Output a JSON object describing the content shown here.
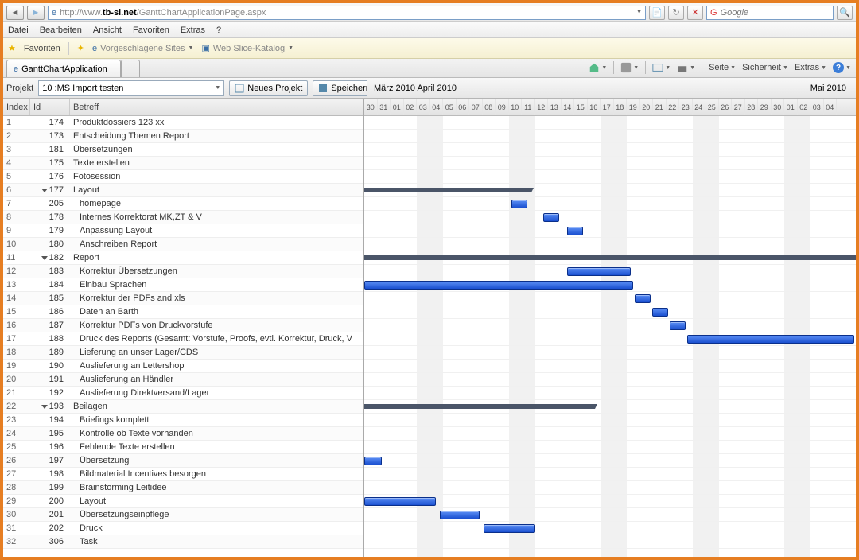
{
  "url_prefix": "http://www.",
  "url_domain": "tb-sl.net",
  "url_path": "/GanttChartApplicationPage.aspx",
  "search_engine": "Google",
  "menu": [
    "Datei",
    "Bearbeiten",
    "Ansicht",
    "Favoriten",
    "Extras",
    "?"
  ],
  "fav_label": "Favoriten",
  "fav_links": [
    "Vorgeschlagene Sites",
    "Web Slice-Katalog"
  ],
  "tab_title": "GanttChartApplication",
  "page_tools": [
    "Seite",
    "Sicherheit",
    "Extras"
  ],
  "project_label": "Projekt",
  "project_value": "10 :MS Import testen",
  "btn_new": "Neues Projekt",
  "btn_save": "Speichern",
  "month_left": "März 2010",
  "month_mid": "April 2010",
  "month_right": "Mai 2010",
  "col_index": "Index",
  "col_id": "Id",
  "col_betreff": "Betreff",
  "days": [
    "30",
    "31",
    "01",
    "02",
    "03",
    "04",
    "05",
    "06",
    "07",
    "08",
    "09",
    "10",
    "11",
    "12",
    "13",
    "14",
    "15",
    "16",
    "17",
    "18",
    "19",
    "20",
    "21",
    "22",
    "23",
    "24",
    "25",
    "26",
    "27",
    "28",
    "29",
    "30",
    "01",
    "02",
    "03",
    "04"
  ],
  "tasks": [
    {
      "idx": 1,
      "id": 174,
      "t": "Produktdossiers 123 xx"
    },
    {
      "idx": 2,
      "id": 173,
      "t": "Entscheidung Themen Report"
    },
    {
      "idx": 3,
      "id": 181,
      "t": "Übersetzungen"
    },
    {
      "idx": 4,
      "id": 175,
      "t": "Texte erstellen"
    },
    {
      "idx": 5,
      "id": 176,
      "t": "Fotosession"
    },
    {
      "idx": 6,
      "id": 177,
      "t": "Layout",
      "grp": true,
      "sum": [
        0,
        210
      ]
    },
    {
      "idx": 7,
      "id": 205,
      "t": "homepage",
      "bar": [
        185,
        20
      ]
    },
    {
      "idx": 8,
      "id": 178,
      "t": "Internes Korrektorat MK,ZT & V",
      "bar": [
        225,
        20
      ]
    },
    {
      "idx": 9,
      "id": 179,
      "t": "Anpassung Layout",
      "bar": [
        255,
        20
      ]
    },
    {
      "idx": 10,
      "id": 180,
      "t": "Anschreiben Report"
    },
    {
      "idx": 11,
      "id": 182,
      "t": "Report",
      "grp": true,
      "sum": [
        0,
        620
      ]
    },
    {
      "idx": 12,
      "id": 183,
      "t": "Korrektur Übersetzungen",
      "bar": [
        255,
        80
      ]
    },
    {
      "idx": 13,
      "id": 184,
      "t": "Einbau Sprachen",
      "bar": [
        0,
        338
      ]
    },
    {
      "idx": 14,
      "id": 185,
      "t": "Korrektur der PDFs and xls",
      "bar": [
        340,
        20
      ]
    },
    {
      "idx": 15,
      "id": 186,
      "t": "Daten an Barth",
      "bar": [
        362,
        20
      ]
    },
    {
      "idx": 16,
      "id": 187,
      "t": "Korrektur PDFs von Druckvorstufe",
      "bar": [
        384,
        20
      ]
    },
    {
      "idx": 17,
      "id": 188,
      "t": "Druck des Reports (Gesamt: Vorstufe, Proofs, evtl. Korrektur, Druck, V",
      "bar": [
        406,
        210
      ]
    },
    {
      "idx": 18,
      "id": 189,
      "t": "Lieferung an unser Lager/CDS"
    },
    {
      "idx": 19,
      "id": 190,
      "t": "Auslieferung an Lettershop"
    },
    {
      "idx": 20,
      "id": 191,
      "t": "Auslieferung an Händler"
    },
    {
      "idx": 21,
      "id": 192,
      "t": "Auslieferung Direktversand/Lager"
    },
    {
      "idx": 22,
      "id": 193,
      "t": "Beilagen",
      "grp": true,
      "sum": [
        0,
        290
      ]
    },
    {
      "idx": 23,
      "id": 194,
      "t": "Briefings komplett"
    },
    {
      "idx": 24,
      "id": 195,
      "t": "Kontrolle ob Texte vorhanden"
    },
    {
      "idx": 25,
      "id": 196,
      "t": "Fehlende Texte erstellen"
    },
    {
      "idx": 26,
      "id": 197,
      "t": "Übersetzung",
      "bar": [
        0,
        22
      ]
    },
    {
      "idx": 27,
      "id": 198,
      "t": "Bildmaterial Incentives besorgen"
    },
    {
      "idx": 28,
      "id": 199,
      "t": "Brainstorming Leitidee"
    },
    {
      "idx": 29,
      "id": 200,
      "t": "Layout",
      "bar": [
        0,
        90
      ]
    },
    {
      "idx": 30,
      "id": 201,
      "t": "Übersetzungseinpflege",
      "bar": [
        95,
        50
      ]
    },
    {
      "idx": 31,
      "id": 202,
      "t": "Druck",
      "bar": [
        150,
        65
      ]
    },
    {
      "idx": 32,
      "id": 306,
      "t": "Task"
    }
  ],
  "chart_data": {
    "type": "gantt",
    "title": "GanttChartApplication",
    "date_range": [
      "2010-03-30",
      "2010-05-04"
    ],
    "series": [
      {
        "id": 177,
        "name": "Layout",
        "type": "summary",
        "start": "2010-03-30",
        "end": "2010-04-11"
      },
      {
        "id": 205,
        "name": "homepage",
        "start": "2010-04-10",
        "end": "2010-04-11"
      },
      {
        "id": 178,
        "name": "Internes Korrektorat MK,ZT & V",
        "start": "2010-04-13",
        "end": "2010-04-14"
      },
      {
        "id": 179,
        "name": "Anpassung Layout",
        "start": "2010-04-15",
        "end": "2010-04-16"
      },
      {
        "id": 182,
        "name": "Report",
        "type": "summary",
        "start": "2010-03-30",
        "end": "2010-05-04"
      },
      {
        "id": 183,
        "name": "Korrektur Übersetzungen",
        "start": "2010-04-15",
        "end": "2010-04-19"
      },
      {
        "id": 184,
        "name": "Einbau Sprachen",
        "start": "2010-03-30",
        "end": "2010-04-19"
      },
      {
        "id": 185,
        "name": "Korrektur der PDFs and xls",
        "start": "2010-04-20",
        "end": "2010-04-21"
      },
      {
        "id": 186,
        "name": "Daten an Barth",
        "start": "2010-04-21",
        "end": "2010-04-22"
      },
      {
        "id": 187,
        "name": "Korrektur PDFs von Druckvorstufe",
        "start": "2010-04-22",
        "end": "2010-04-23"
      },
      {
        "id": 188,
        "name": "Druck des Reports",
        "start": "2010-04-24",
        "end": "2010-05-04"
      },
      {
        "id": 193,
        "name": "Beilagen",
        "type": "summary",
        "start": "2010-03-30",
        "end": "2010-04-16"
      },
      {
        "id": 197,
        "name": "Übersetzung",
        "start": "2010-03-30",
        "end": "2010-03-31"
      },
      {
        "id": 200,
        "name": "Layout",
        "start": "2010-03-30",
        "end": "2010-04-04"
      },
      {
        "id": 201,
        "name": "Übersetzungseinpflege",
        "start": "2010-04-05",
        "end": "2010-04-07"
      },
      {
        "id": 202,
        "name": "Druck",
        "start": "2010-04-08",
        "end": "2010-04-11"
      }
    ]
  }
}
